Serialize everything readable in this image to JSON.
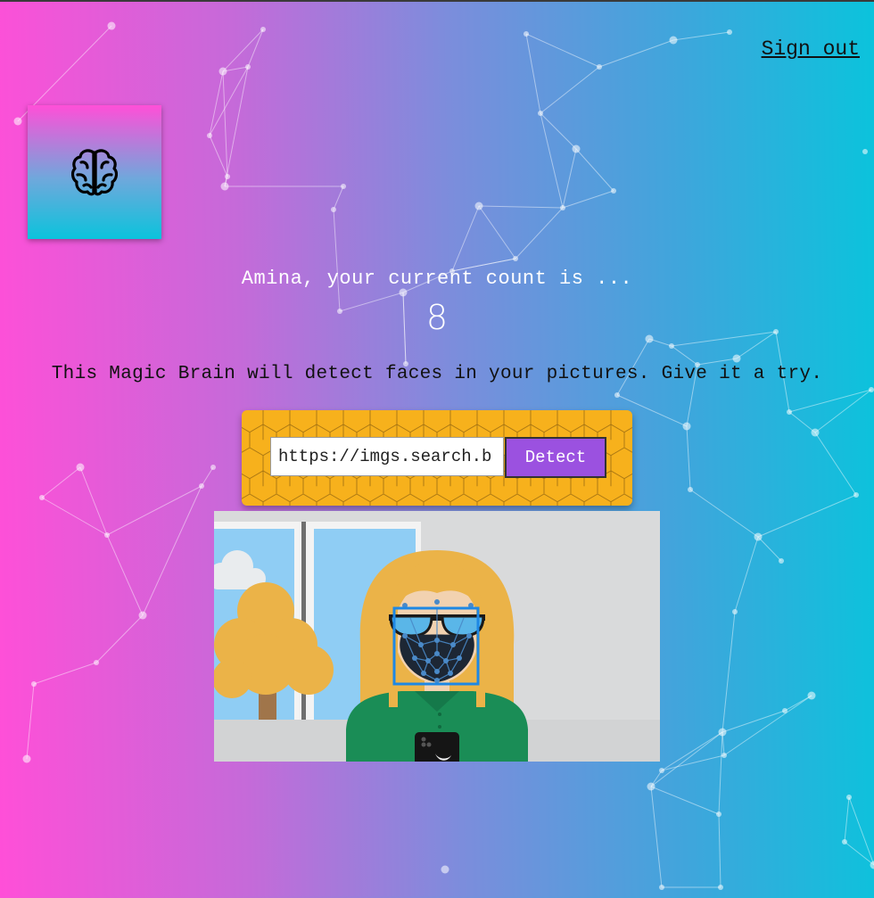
{
  "nav": {
    "signout_label": "Sign out"
  },
  "logo": {
    "icon": "brain-icon"
  },
  "rank": {
    "message": "Amina, your current count is ...",
    "count": "8"
  },
  "tagline": "This Magic Brain will detect faces in your pictures. Give it a try.",
  "form": {
    "input_value": "https://imgs.search.b",
    "detect_label": "Detect"
  },
  "colors": {
    "panel": "#f7b11c",
    "button": "#9b51e0",
    "face_box": "#1e88e5"
  }
}
